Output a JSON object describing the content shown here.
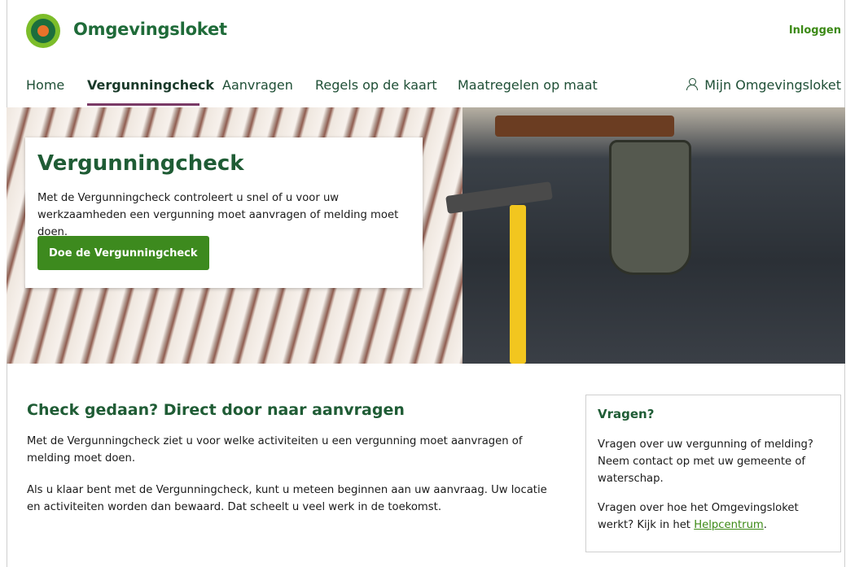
{
  "header": {
    "brand": "Omgevingsloket",
    "login": "Inloggen"
  },
  "nav": {
    "items": [
      "Home",
      "Vergunningcheck",
      "Aanvragen",
      "Regels op de kaart",
      "Maatregelen op maat"
    ],
    "active": "Vergunningcheck",
    "mijn": "Mijn Omgevingsloket"
  },
  "hero": {
    "title": "Vergunningcheck",
    "description": "Met de Vergunningcheck controleert u snel of u voor uw werkzaamheden een vergunning moet aanvragen of melding moet doen.",
    "cta": "Doe de Vergunningcheck"
  },
  "main": {
    "heading": "Check gedaan? Direct door naar aanvragen",
    "p1": "Met de Vergunningcheck ziet u voor welke activiteiten u een vergunning moet aanvragen of melding moet doen.",
    "p2": "Als u klaar bent met de Vergunningcheck, kunt u meteen beginnen aan uw aanvraag. Uw locatie en activiteiten worden dan bewaard. Dat scheelt u veel werk in de toekomst."
  },
  "sidebar": {
    "title": "Vragen?",
    "p1": "Vragen over uw vergunning of melding? Neem contact op met uw gemeente of waterschap.",
    "p2_prefix": "Vragen over hoe het Omgevingsloket werkt? Kijk in het ",
    "p2_link": "Helpcentrum",
    "p2_suffix": "."
  },
  "colors": {
    "brand_green": "#1f5c35",
    "button_green": "#3d8a1e",
    "link_green": "#3c8a16",
    "active_underline": "#7a3a66"
  }
}
